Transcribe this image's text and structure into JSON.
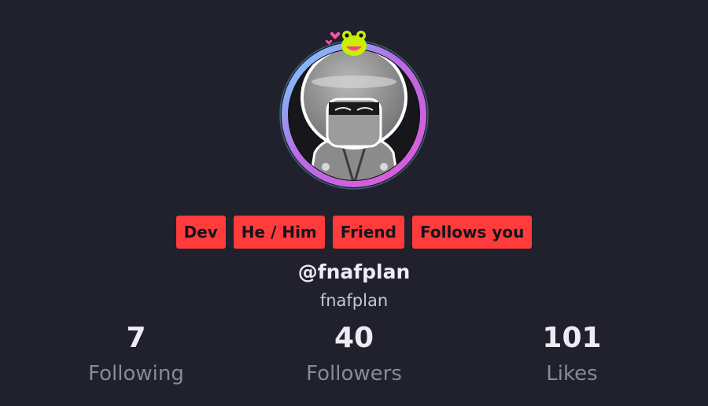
{
  "profile": {
    "badges": [
      "Dev",
      "He / Him",
      "Friend",
      "Follows you"
    ],
    "handle": "@fnafplan",
    "display_name": "fnafplan"
  },
  "stats": {
    "following": {
      "value": "7",
      "label": "Following"
    },
    "followers": {
      "value": "40",
      "label": "Followers"
    },
    "likes": {
      "value": "101",
      "label": "Likes"
    }
  },
  "colors": {
    "background": "#21212e",
    "badge": "#ff3b3b",
    "ring_start": "#6fd8ff",
    "ring_end": "#e05ad6"
  },
  "icons": {
    "avatar": "hooded-figure-avatar",
    "decoration": "frog-icon"
  }
}
